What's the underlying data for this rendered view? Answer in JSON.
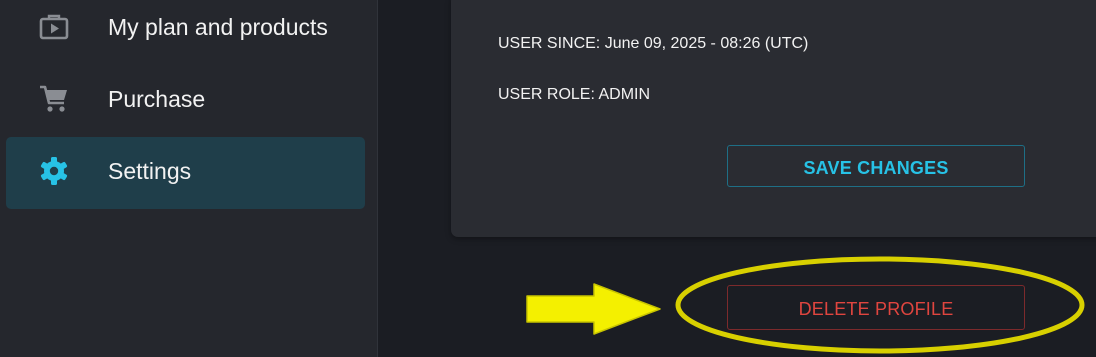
{
  "sidebar": {
    "items": [
      {
        "label": "My plan and products",
        "icon": "play-briefcase-icon",
        "active": false
      },
      {
        "label": "Purchase",
        "icon": "cart-icon",
        "active": false
      },
      {
        "label": "Settings",
        "icon": "gear-icon",
        "active": true
      }
    ]
  },
  "profile": {
    "user_since": "USER SINCE: June 09, 2025 - 08:26 (UTC)",
    "user_role": "USER ROLE: ADMIN",
    "save_label": "SAVE CHANGES",
    "delete_label": "DELETE PROFILE"
  },
  "annotation": {
    "arrow_icon": "right-arrow-icon",
    "highlight_shape": "ellipse",
    "color": "#d8d000"
  },
  "colors": {
    "accent": "#27c2e6",
    "danger": "#e0453f",
    "active_bg": "#1f3e4a",
    "sidebar_bg": "#25272d",
    "main_bg": "#1b1d23",
    "card_bg": "#2a2c32"
  }
}
